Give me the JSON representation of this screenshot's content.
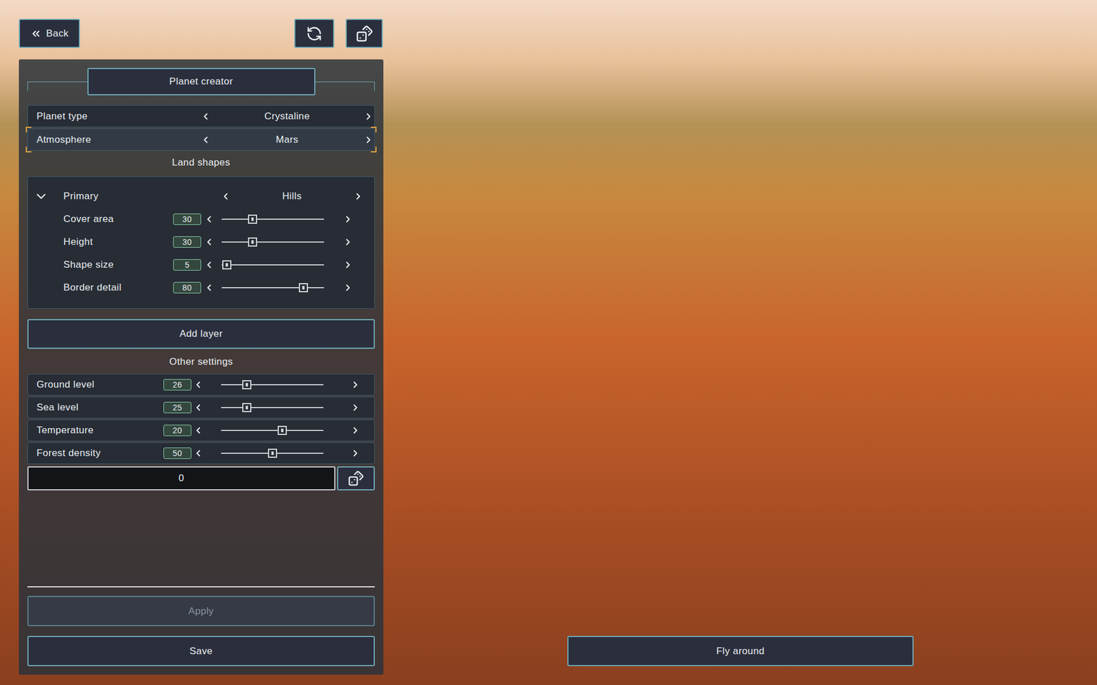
{
  "top_bar": {
    "back": "Back"
  },
  "panel": {
    "title": "Planet creator"
  },
  "selectors": [
    {
      "label": "Planet type",
      "value": "Crystaline",
      "selected": false
    },
    {
      "label": "Atmosphere",
      "value": "Mars",
      "selected": true
    }
  ],
  "land_shapes": {
    "title": "Land shapes",
    "layers": [
      {
        "label": "Primary",
        "value": "Hills",
        "expanded": true,
        "params": [
          {
            "label": "Cover area",
            "value": "30",
            "level": 0.3
          },
          {
            "label": "Height",
            "value": "30",
            "level": 0.3
          },
          {
            "label": "Shape size",
            "value": "5",
            "level": 0.05
          },
          {
            "label": "Border detail",
            "value": "80",
            "level": 0.8
          }
        ]
      }
    ]
  },
  "add_layer": "Add layer",
  "other_settings": {
    "title": "Other settings",
    "params": [
      {
        "label": "Ground level",
        "value": "26",
        "level": 0.25
      },
      {
        "label": "Sea level",
        "value": "25",
        "level": 0.25
      },
      {
        "label": "Temperature",
        "value": "20",
        "level": 0.6
      },
      {
        "label": "Forest density",
        "value": "50",
        "level": 0.5
      }
    ]
  },
  "seed": {
    "value": "0"
  },
  "buttons": [
    {
      "label": "Apply",
      "disabled": true
    },
    {
      "label": "Save",
      "disabled": false
    }
  ],
  "fly_around": "Fly around"
}
